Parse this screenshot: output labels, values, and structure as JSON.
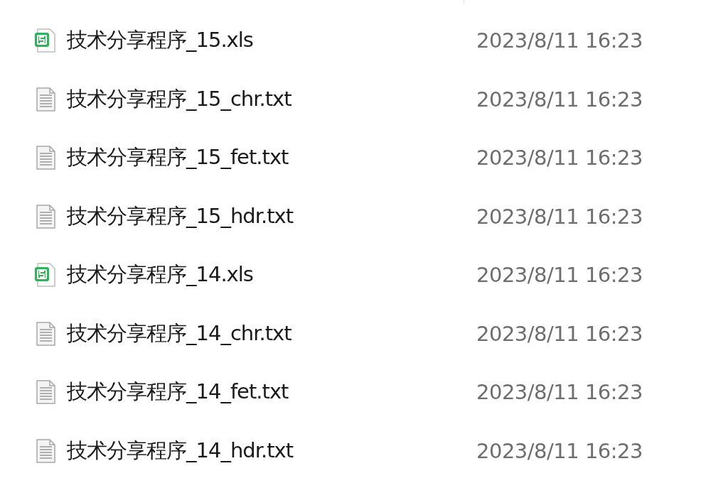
{
  "files": [
    {
      "kind": "spreadsheet",
      "name": "技术分享程序_15.xls",
      "modified": "2023/8/11 16:23"
    },
    {
      "kind": "text",
      "name": "技术分享程序_15_chr.txt",
      "modified": "2023/8/11 16:23"
    },
    {
      "kind": "text",
      "name": "技术分享程序_15_fet.txt",
      "modified": "2023/8/11 16:23"
    },
    {
      "kind": "text",
      "name": "技术分享程序_15_hdr.txt",
      "modified": "2023/8/11 16:23"
    },
    {
      "kind": "spreadsheet",
      "name": "技术分享程序_14.xls",
      "modified": "2023/8/11 16:23"
    },
    {
      "kind": "text",
      "name": "技术分享程序_14_chr.txt",
      "modified": "2023/8/11 16:23"
    },
    {
      "kind": "text",
      "name": "技术分享程序_14_fet.txt",
      "modified": "2023/8/11 16:23"
    },
    {
      "kind": "text",
      "name": "技术分享程序_14_hdr.txt",
      "modified": "2023/8/11 16:23"
    }
  ]
}
